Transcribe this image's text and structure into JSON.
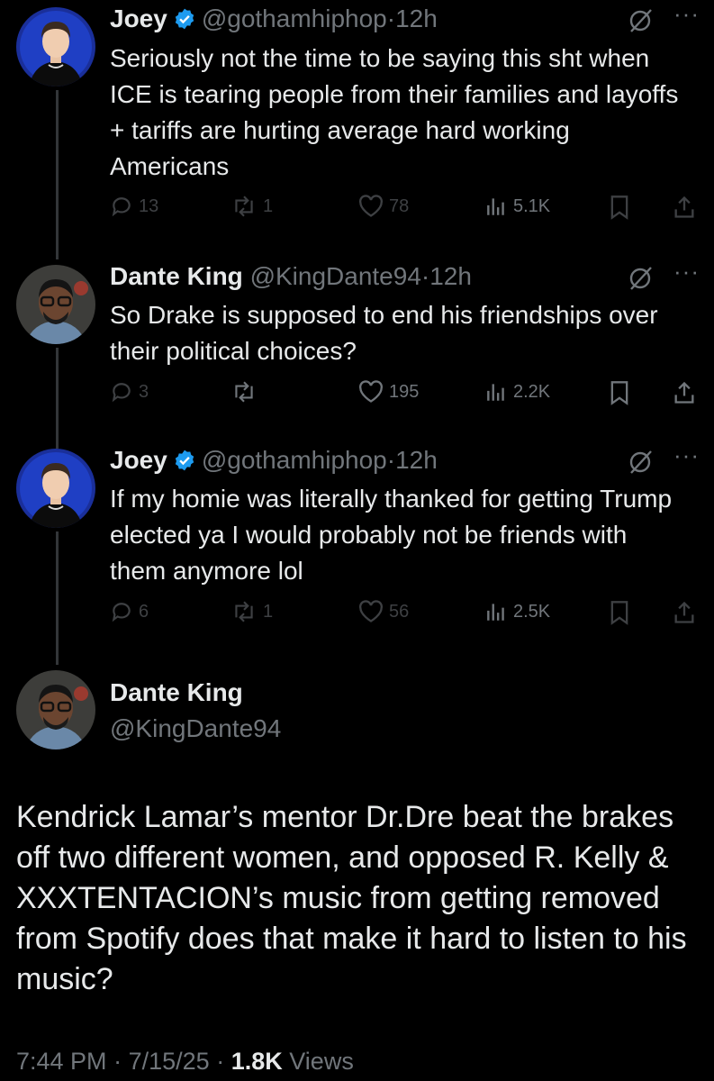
{
  "thread": [
    {
      "name": "Joey",
      "handle": "@gothamhiphop",
      "time": "12h",
      "text": "Seriously not the time to be saying this sht when ICE is tearing people from their families and layoffs + tariffs are hurting average hard working Americans",
      "replies": "13",
      "reposts": "1",
      "likes": "78",
      "views": "5.1K",
      "verified": true,
      "dim": true
    },
    {
      "name": "Dante King",
      "handle": "@KingDante94",
      "time": "12h",
      "text": "So Drake is supposed to end his friendships over their political choices?",
      "replies": "3",
      "reposts": "",
      "likes": "195",
      "views": "2.2K",
      "verified": false,
      "dim": false
    },
    {
      "name": "Joey",
      "handle": "@gothamhiphop",
      "time": "12h",
      "text": "If my homie was literally thanked for getting Trump elected ya I would probably not be friends with them anymore lol",
      "replies": "6",
      "reposts": "1",
      "likes": "56",
      "views": "2.5K",
      "verified": true,
      "dim": true
    }
  ],
  "main": {
    "name": "Dante King",
    "handle": "@KingDante94",
    "text": "Kendrick Lamar’s mentor Dr.Dre beat the brakes off two different women, and opposed R. Kelly & XXXTENTACION’s music from getting removed from Spotify does that make it hard to listen to his music?",
    "time": "7:44 PM",
    "date": "7/15/25",
    "views_count": "1.8K",
    "views_label": "Views"
  },
  "separator": "·",
  "more_glyph": "···",
  "colors": {
    "background": "#000000",
    "text": "#e7e9ea",
    "muted": "#71767b",
    "verified": "#1d9bf0",
    "thread_line": "#333639"
  },
  "icons": [
    "verified-badge-icon",
    "grok-icon",
    "more-icon",
    "reply-icon",
    "repost-icon",
    "like-icon",
    "views-icon",
    "bookmark-icon",
    "share-icon"
  ]
}
